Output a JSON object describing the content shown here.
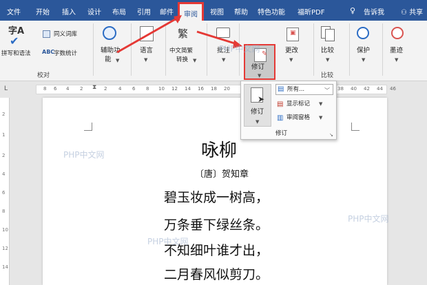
{
  "tabs": [
    "文件",
    "开始",
    "插入",
    "设计",
    "布局",
    "引用",
    "邮件",
    "审阅",
    "视图",
    "帮助",
    "特色功能",
    "福昕PDF",
    "告诉我",
    "共享"
  ],
  "active_tab_index": 7,
  "ribbon": {
    "proofing": {
      "spelling_label": "拼写和语法",
      "thesaurus_label": "同义词库",
      "wordcount_label": "字数统计",
      "group_label": "校对"
    },
    "accessibility_label_line1": "辅助功",
    "accessibility_label_line2": "能",
    "language_label": "语言",
    "chinese_convert_line1": "中文简繁",
    "chinese_convert_line2": "转换",
    "comment_label": "批注",
    "track_label": "修订",
    "changes_label": "更改",
    "compare_label": "比较",
    "compare_group_label": "比较",
    "protect_label": "保护",
    "ink_label": "墨迹"
  },
  "dropdown": {
    "track_label": "修订",
    "markup_value": "所有...",
    "show_markup_label": "显示标记",
    "review_pane_label": "审阅窗格",
    "group_label": "修订"
  },
  "ruler_ticks": [
    "8",
    "6",
    "4",
    "2",
    "2",
    "4",
    "6",
    "8",
    "10",
    "12",
    "14",
    "16",
    "18",
    "20",
    "22",
    "24",
    "26",
    "28",
    "30",
    "32",
    "34",
    "36",
    "38",
    "40",
    "42",
    "44",
    "46"
  ],
  "vruler_ticks": [
    "2",
    "1",
    "2",
    "4",
    "6",
    "8",
    "10",
    "12",
    "14",
    "16"
  ],
  "document": {
    "title": "咏柳",
    "author": "〔唐〕贺知章",
    "lines": [
      "碧玉妆成一树高，",
      "万条垂下绿丝条。",
      "不知细叶谁才出，",
      "二月春风似剪刀。"
    ]
  },
  "watermarks": [
    "PHP中文网",
    "PHP中文网",
    "PHP中文网",
    "PHP中文网"
  ],
  "colors": {
    "title_bar": "#2b579a",
    "highlight_red": "#e53935",
    "ribbon_bg": "#f3f3f3"
  }
}
